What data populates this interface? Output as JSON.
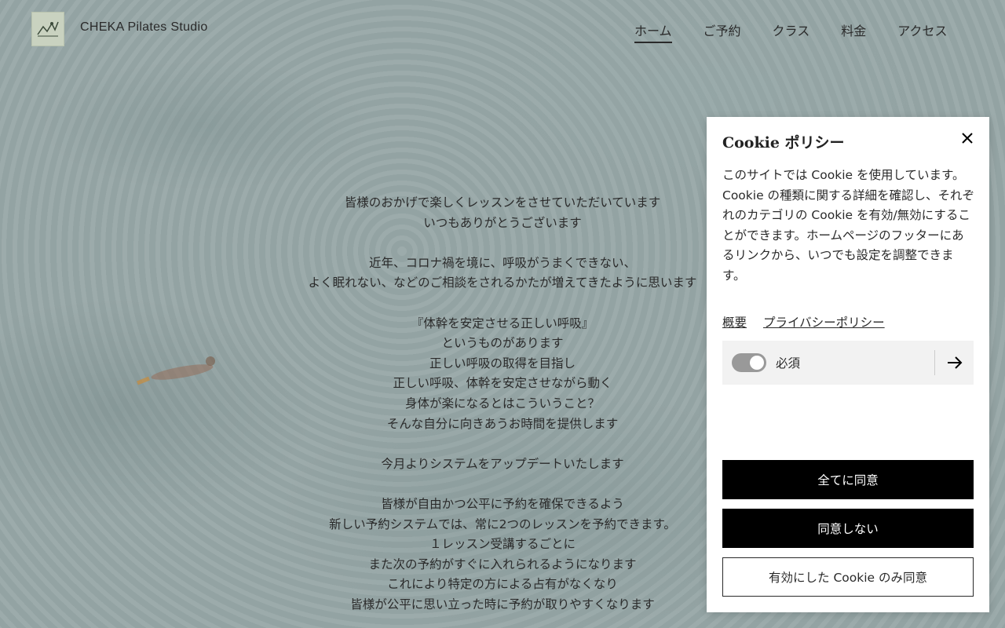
{
  "brand": {
    "name": "CHEKA Pilates Studio"
  },
  "nav": {
    "items": [
      {
        "label": "ホーム"
      },
      {
        "label": "ご予約"
      },
      {
        "label": "クラス"
      },
      {
        "label": "料金"
      },
      {
        "label": "アクセス"
      }
    ]
  },
  "content": {
    "lines": [
      "皆様のおかげで楽しくレッスンをさせていただいています",
      "いつもありがとうございます",
      "",
      "近年、コロナ禍を境に、呼吸がうまくできない、",
      "よく眠れない、などのご相談をされるかたが増えてきたように思います",
      "",
      "『体幹を安定させる正しい呼吸』",
      "というものがあります",
      "正しい呼吸の取得を目指し",
      "正しい呼吸、体幹を安定させながら動く",
      "身体が楽になるとはこういうこと？",
      "そんな自分に向きあうお時間を提供します",
      "",
      "今月よりシステムをアップデートいたします",
      "",
      "皆様が自由かつ公平に予約を確保できるよう",
      "新しい予約システムでは、常に2つのレッスンを予約できます。",
      "１レッスン受講するごとに",
      "また次の予約がすぐに入れられるようになります",
      "これにより特定の方による占有がなくなり",
      "皆様が公平に思い立った時に予約が取りやすくなります"
    ]
  },
  "cookie": {
    "title": "Cookie ポリシー",
    "body": "このサイトでは Cookie を使用しています。Cookie の種類に関する詳細を確認し、それぞれのカテゴリの Cookie を有効/無効にすることができます。ホームページのフッターにあるリンクから、いつでも設定を調整できます。",
    "links": {
      "overview": "概要",
      "privacy": "プライバシーポリシー"
    },
    "category": {
      "label": "必須",
      "enabled": true
    },
    "buttons": {
      "accept_all": "全てに同意",
      "decline": "同意しない",
      "accept_selected": "有効にした Cookie のみ同意"
    }
  },
  "colors": {
    "accent": "#000000",
    "panel_bg": "#ffffff",
    "toggle": "#999999"
  }
}
